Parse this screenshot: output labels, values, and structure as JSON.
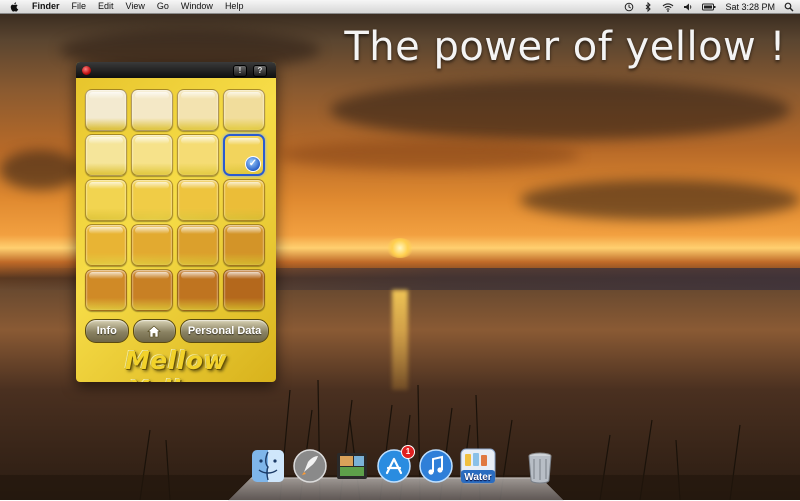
{
  "menubar": {
    "app_name": "Finder",
    "menus": [
      "File",
      "Edit",
      "View",
      "Go",
      "Window",
      "Help"
    ],
    "clock": "Sat 3:28 PM",
    "icons": [
      "apple-icon",
      "time-machine-icon",
      "bluetooth-icon",
      "wifi-icon",
      "volume-icon",
      "battery-icon",
      "spotlight-icon"
    ]
  },
  "headline": "The power of yellow !",
  "widget": {
    "title_buttons": [
      "!",
      "?"
    ],
    "grid_colors": [
      "#f3ead0",
      "#f4e8c6",
      "#f3e3b0",
      "#f1dd9c",
      "#f5e59a",
      "#f6e28a",
      "#f5dc74",
      "#f2d45c",
      "#f2d450",
      "#f0cc46",
      "#eec43e",
      "#ebbd38",
      "#e8b434",
      "#e2aa30",
      "#dba02c",
      "#d39428",
      "#d08a26",
      "#c88024",
      "#bf7420",
      "#b4681c"
    ],
    "selected_index": 7,
    "buttons": {
      "info": "Info",
      "personal_data": "Personal Data"
    },
    "brand": "Mellow Yellow"
  },
  "dock": {
    "items": [
      {
        "name": "finder",
        "icon": "finder-icon"
      },
      {
        "name": "launchpad",
        "icon": "rocket-icon"
      },
      {
        "name": "preview",
        "icon": "preview-icon"
      },
      {
        "name": "app-store",
        "icon": "app-store-icon",
        "badge": "1"
      },
      {
        "name": "itunes",
        "icon": "music-note-icon"
      },
      {
        "name": "water",
        "icon": "water-app-icon",
        "label": "Water"
      },
      {
        "name": "trash",
        "icon": "trash-icon"
      }
    ]
  }
}
